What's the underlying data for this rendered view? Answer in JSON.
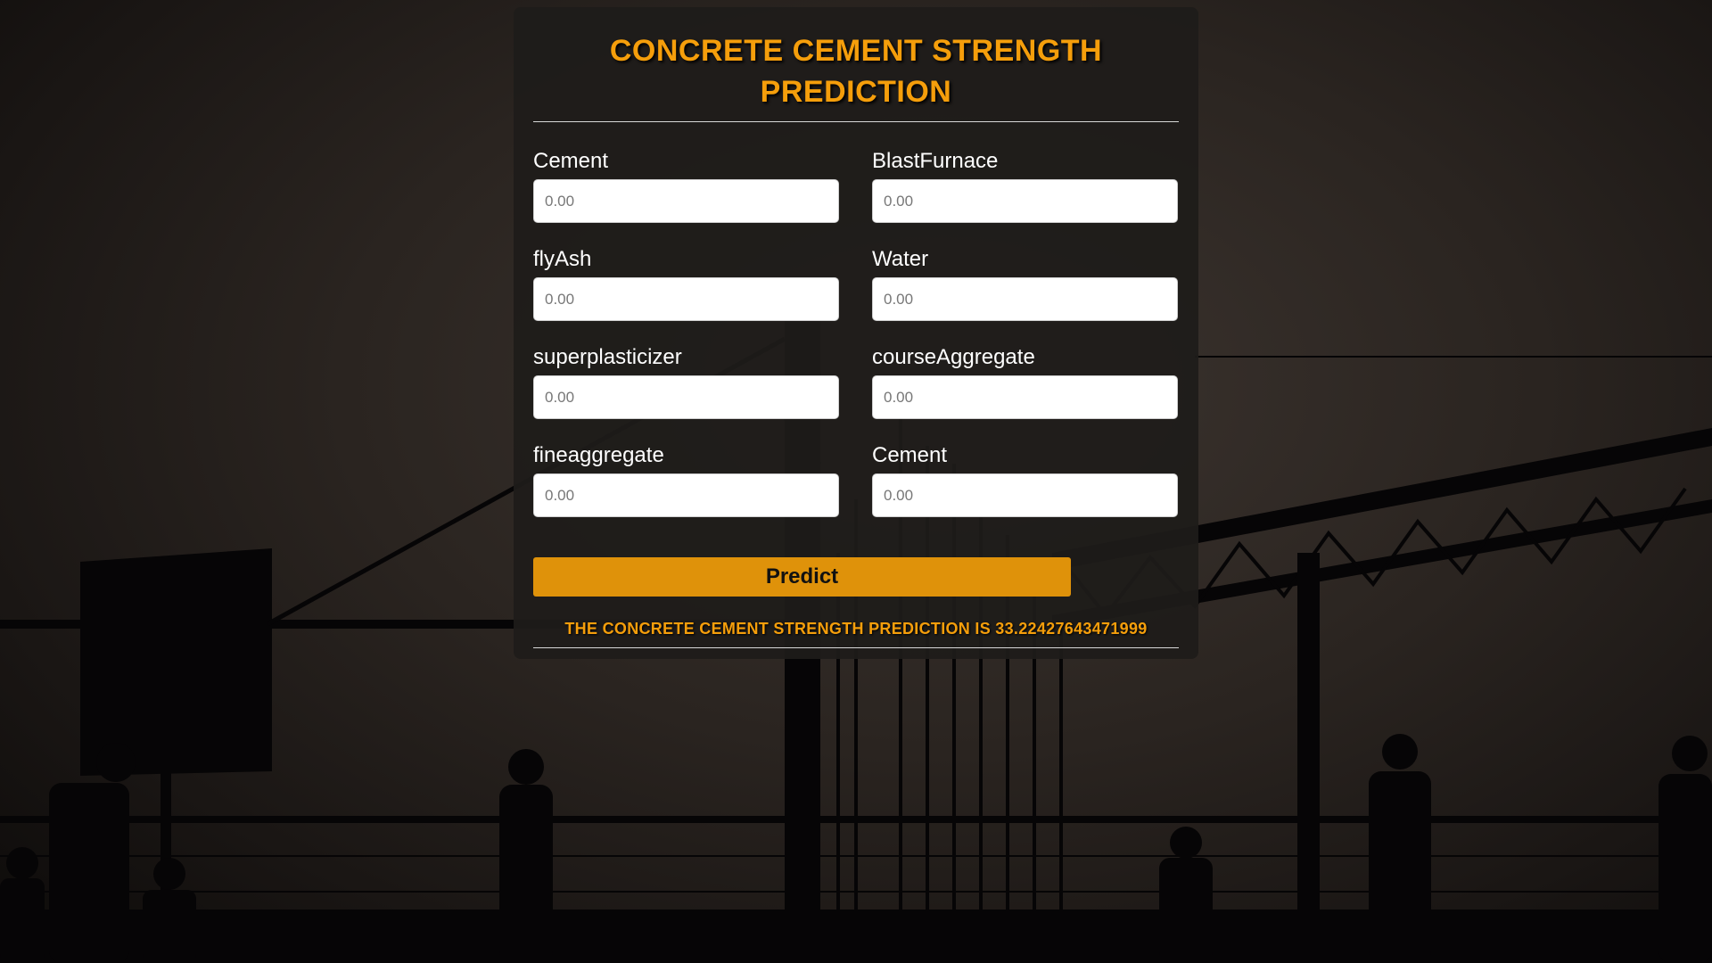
{
  "page": {
    "title": "CONCRETE CEMENT STRENGTH PREDICTION"
  },
  "form": {
    "fields": [
      {
        "label": "Cement",
        "placeholder": "0.00"
      },
      {
        "label": "BlastFurnace",
        "placeholder": "0.00"
      },
      {
        "label": "flyAsh",
        "placeholder": "0.00"
      },
      {
        "label": "Water",
        "placeholder": "0.00"
      },
      {
        "label": "superplasticizer",
        "placeholder": "0.00"
      },
      {
        "label": "courseAggregate",
        "placeholder": "0.00"
      },
      {
        "label": "fineaggregate",
        "placeholder": "0.00"
      },
      {
        "label": "Cement",
        "placeholder": "0.00"
      }
    ],
    "predict_label": "Predict"
  },
  "result": {
    "text": "THE CONCRETE CEMENT STRENGTH PREDICTION IS 33.22427643471999"
  },
  "colors": {
    "accent": "#f59e0b",
    "button": "#df920a",
    "card_bg": "#1e1c1a"
  }
}
